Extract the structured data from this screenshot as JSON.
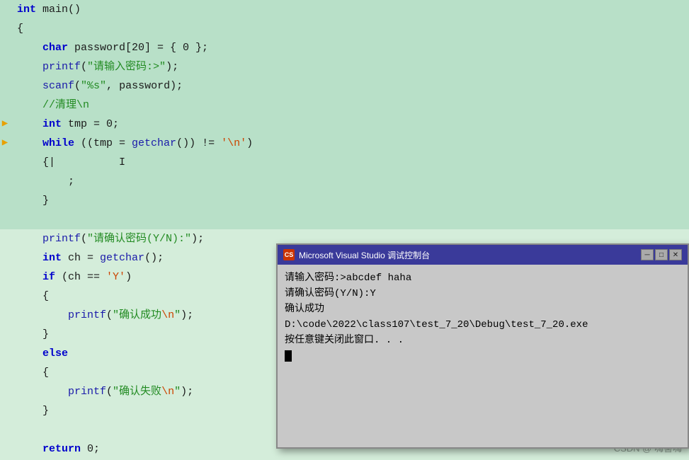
{
  "editor": {
    "background": "#d4edda",
    "lines": [
      {
        "num": "",
        "arrow": false,
        "indent": 0,
        "tokens": [
          {
            "t": "kw-type",
            "v": "int"
          },
          {
            "t": "normal",
            "v": " main()"
          }
        ]
      },
      {
        "num": "",
        "indent": 0,
        "tokens": [
          {
            "t": "normal",
            "v": "{"
          }
        ]
      },
      {
        "num": "",
        "indent": 1,
        "tokens": [
          {
            "t": "kw-type",
            "v": "char"
          },
          {
            "t": "normal",
            "v": " password[20] = { 0 };"
          }
        ]
      },
      {
        "num": "",
        "indent": 1,
        "tokens": [
          {
            "t": "fn",
            "v": "printf"
          },
          {
            "t": "normal",
            "v": "("
          },
          {
            "t": "str",
            "v": "\"请输入密码:>\""
          },
          {
            "t": "normal",
            "v": ");"
          }
        ]
      },
      {
        "num": "",
        "indent": 1,
        "tokens": [
          {
            "t": "fn",
            "v": "scanf"
          },
          {
            "t": "normal",
            "v": "("
          },
          {
            "t": "str",
            "v": "\"%s\""
          },
          {
            "t": "normal",
            "v": ", password);"
          }
        ]
      },
      {
        "num": "",
        "indent": 1,
        "tokens": [
          {
            "t": "comment",
            "v": "//清理\\n"
          }
        ]
      },
      {
        "num": "",
        "arrow": true,
        "indent": 1,
        "tokens": [
          {
            "t": "kw-type",
            "v": "int"
          },
          {
            "t": "normal",
            "v": " tmp = 0;"
          }
        ]
      },
      {
        "num": "",
        "arrow": true,
        "indent": 1,
        "tokens": [
          {
            "t": "kw",
            "v": "while"
          },
          {
            "t": "normal",
            "v": " ((tmp = "
          },
          {
            "t": "fn",
            "v": "getchar"
          },
          {
            "t": "normal",
            "v": "()) != "
          },
          {
            "t": "char-lit",
            "v": "'\\n'"
          },
          {
            "t": "normal",
            "v": ")"
          }
        ]
      },
      {
        "num": "",
        "indent": 1,
        "tokens": [
          {
            "t": "normal",
            "v": "{|"
          },
          {
            "t": "normal",
            "v": "          I"
          }
        ]
      },
      {
        "num": "",
        "indent": 2,
        "tokens": [
          {
            "t": "normal",
            "v": ";"
          }
        ]
      },
      {
        "num": "",
        "indent": 1,
        "tokens": [
          {
            "t": "normal",
            "v": "}"
          }
        ]
      },
      {
        "num": "",
        "indent": 0,
        "tokens": []
      },
      {
        "num": "",
        "indent": 1,
        "tokens": [
          {
            "t": "fn",
            "v": "printf"
          },
          {
            "t": "normal",
            "v": "("
          },
          {
            "t": "str",
            "v": "\"请确认密码(Y/N):\""
          },
          {
            "t": "normal",
            "v": ");"
          }
        ]
      },
      {
        "num": "",
        "indent": 1,
        "tokens": [
          {
            "t": "kw-type",
            "v": "int"
          },
          {
            "t": "normal",
            "v": " ch = "
          },
          {
            "t": "fn",
            "v": "getchar"
          },
          {
            "t": "normal",
            "v": "();"
          }
        ]
      },
      {
        "num": "",
        "indent": 1,
        "tokens": [
          {
            "t": "kw",
            "v": "if"
          },
          {
            "t": "normal",
            "v": " (ch == "
          },
          {
            "t": "char-lit",
            "v": "'Y'"
          },
          {
            "t": "normal",
            "v": ")"
          }
        ]
      },
      {
        "num": "",
        "indent": 1,
        "tokens": [
          {
            "t": "normal",
            "v": "{"
          }
        ]
      },
      {
        "num": "",
        "indent": 2,
        "tokens": [
          {
            "t": "fn",
            "v": "printf"
          },
          {
            "t": "normal",
            "v": "("
          },
          {
            "t": "str",
            "v": "\"确认成功"
          },
          {
            "t": "str-special",
            "v": "\\n"
          },
          {
            "t": "str",
            "v": "\""
          },
          {
            "t": "normal",
            "v": ");"
          }
        ]
      },
      {
        "num": "",
        "indent": 1,
        "tokens": [
          {
            "t": "normal",
            "v": "}"
          }
        ]
      },
      {
        "num": "",
        "indent": 1,
        "tokens": [
          {
            "t": "kw",
            "v": "else"
          }
        ]
      },
      {
        "num": "",
        "indent": 1,
        "tokens": [
          {
            "t": "normal",
            "v": "{"
          }
        ]
      },
      {
        "num": "",
        "indent": 2,
        "tokens": [
          {
            "t": "fn",
            "v": "printf"
          },
          {
            "t": "normal",
            "v": "("
          },
          {
            "t": "str",
            "v": "\"确认失败"
          },
          {
            "t": "str-special",
            "v": "\\n"
          },
          {
            "t": "str",
            "v": "\""
          },
          {
            "t": "normal",
            "v": ");"
          }
        ]
      },
      {
        "num": "",
        "indent": 1,
        "tokens": [
          {
            "t": "normal",
            "v": "}"
          }
        ]
      },
      {
        "num": "",
        "indent": 0,
        "tokens": []
      },
      {
        "num": "",
        "indent": 1,
        "tokens": [
          {
            "t": "kw",
            "v": "return"
          },
          {
            "t": "normal",
            "v": " 0;"
          }
        ]
      }
    ]
  },
  "console": {
    "title": "Microsoft Visual Studio 调试控制台",
    "icon_label": "CS",
    "lines": [
      "请输入密码:>abcdef haha",
      "请确认密码(Y/N):Y",
      "确认成功",
      "",
      "D:\\code\\2022\\class107\\test_7_20\\Debug\\test_7_20.exe",
      "按任意键关闭此窗口. . ."
    ]
  },
  "watermark": {
    "text": "CSDN @ 嗨害嗨"
  }
}
